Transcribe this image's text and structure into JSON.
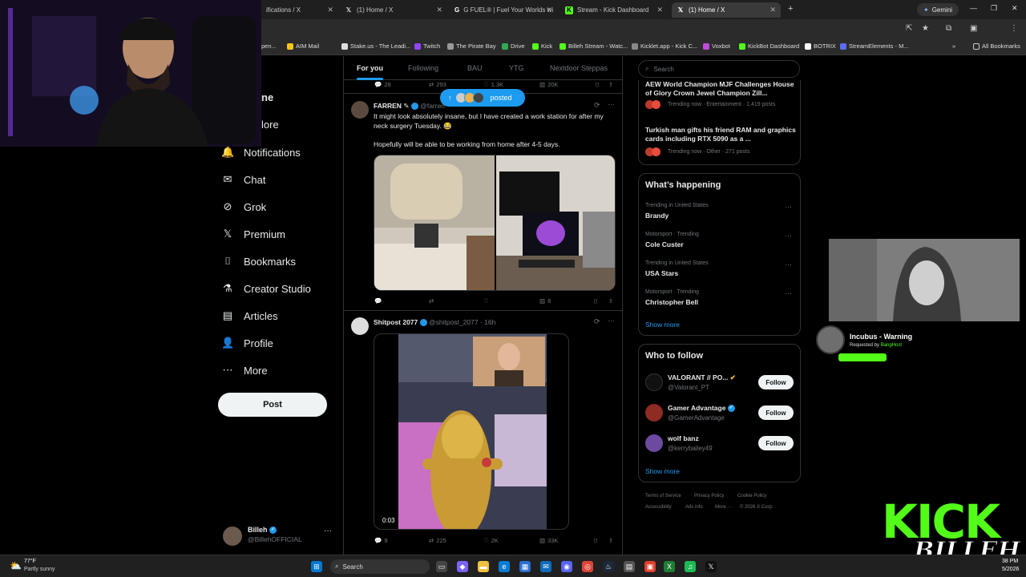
{
  "browser": {
    "tabs": [
      {
        "label": "ifications / X",
        "icon": "X"
      },
      {
        "label": "(1) Home / X",
        "icon": "X"
      },
      {
        "label": "G FUEL® | Fuel Your Worlds wi",
        "icon": "G"
      },
      {
        "label": "Stream - Kick Dashboard",
        "icon": "K"
      },
      {
        "label": "(1) Home / X",
        "icon": "X"
      }
    ],
    "gemini_label": "Gemini",
    "bookmarks": [
      "pen...",
      "AIM Mail",
      "Stake.us - The Leadi...",
      "Twitch",
      "The Pirate Bay",
      "Drive",
      "Kick",
      "Billeh Stream - Watc...",
      "Kicklet.app - Kick C...",
      "Voxbot",
      "KickBot Dashboard",
      "BOTRIX",
      "StreamElements - M..."
    ],
    "all_bookmarks": "All Bookmarks"
  },
  "nav": {
    "items": [
      {
        "label": "ne",
        "icon": "home-icon"
      },
      {
        "label": "lore",
        "icon": "explore-icon"
      },
      {
        "label": "Notifications",
        "icon": "bell-icon",
        "glyph": "🔔"
      },
      {
        "label": "Chat",
        "icon": "mail-icon",
        "glyph": "✉"
      },
      {
        "label": "Grok",
        "icon": "grok-icon",
        "glyph": "⊘"
      },
      {
        "label": "Premium",
        "icon": "x-logo-icon",
        "glyph": "𝕏"
      },
      {
        "label": "Bookmarks",
        "icon": "bookmark-icon",
        "glyph": "⌷"
      },
      {
        "label": "Creator Studio",
        "icon": "flask-icon",
        "glyph": "⚗"
      },
      {
        "label": "Articles",
        "icon": "article-icon",
        "glyph": "▤"
      },
      {
        "label": "Profile",
        "icon": "person-icon",
        "glyph": "👤"
      },
      {
        "label": "More",
        "icon": "more-circle-icon",
        "glyph": "⋯"
      }
    ],
    "post_label": "Post",
    "account": {
      "name": "Billeh",
      "handle": "@BillehOFFICIAL"
    }
  },
  "timeline": {
    "tabs": [
      "For you",
      "Following",
      "BAU",
      "YTG",
      "Nextdoor Steppas"
    ],
    "prev_post_stats": {
      "replies": "28",
      "reposts": "293",
      "likes": "1.3K",
      "views": "20K"
    },
    "posted_pill": "posted",
    "post1": {
      "name": "FARREN",
      "handle": "@farren",
      "text1": "It might look absolutely insane, but I have created a work station for after my neck surgery Tuesday. 😂",
      "text2": "Hopefully will be able to be working from home after 4-5 days.",
      "stats": {
        "views": "8"
      }
    },
    "post2": {
      "name": "Shitpost 2077",
      "handle": "@shitpost_2077",
      "time": "· 16h",
      "video_time": "0:03",
      "stats": {
        "replies": "9",
        "reposts": "225",
        "likes": "2K",
        "views": "33K"
      }
    }
  },
  "right": {
    "search_placeholder": "Search",
    "news": [
      {
        "title": "AEW World Champion MJF Challenges House of Glory Crown Jewel Champion Zill...",
        "meta": "Trending now · Entertainment · 1,419 posts"
      },
      {
        "title": "Turkish man gifts his friend RAM and graphics cards including RTX 5090 as a ...",
        "meta": "Trending now · Other · 271 posts"
      }
    ],
    "happening_title": "What’s happening",
    "trends": [
      {
        "context": "Trending in United States",
        "name": "Brandy"
      },
      {
        "context": "Motorsport · Trending",
        "name": "Cole Custer"
      },
      {
        "context": "Trending in United States",
        "name": "USA Stars"
      },
      {
        "context": "Motorsport · Trending",
        "name": "Christopher Bell"
      }
    ],
    "show_more": "Show more",
    "wtf_title": "Who to follow",
    "follow_label": "Follow",
    "accounts": [
      {
        "name": "VALORANT // PO...",
        "handle": "@Valorant_PT",
        "color": "#ff4655"
      },
      {
        "name": "Gamer Advantage",
        "handle": "@GamerAdvantage",
        "color": "#c0392b"
      },
      {
        "name": "wolf banz",
        "handle": "@kerrybailey49",
        "color": "#6c4aa0"
      }
    ],
    "footer": [
      "Terms of Service",
      "Privacy Policy",
      "Cookie Policy",
      "Accessibility",
      "Ads info",
      "More ···",
      "© 2026 X Corp."
    ]
  },
  "overlay": {
    "song_title": "Incubus - Warning",
    "requested_by": "Requested by",
    "requester": "BangHost",
    "kick_text": "KICK",
    "kick_sub": "BILLEH"
  },
  "taskbar": {
    "weather_temp": "77°F",
    "weather_desc": "Partly sunny",
    "search_label": "Search",
    "clock": "38 PM",
    "date": "5/2026"
  },
  "colors": {
    "accent": "#1d9bf0",
    "kick_green": "#53fc18"
  }
}
